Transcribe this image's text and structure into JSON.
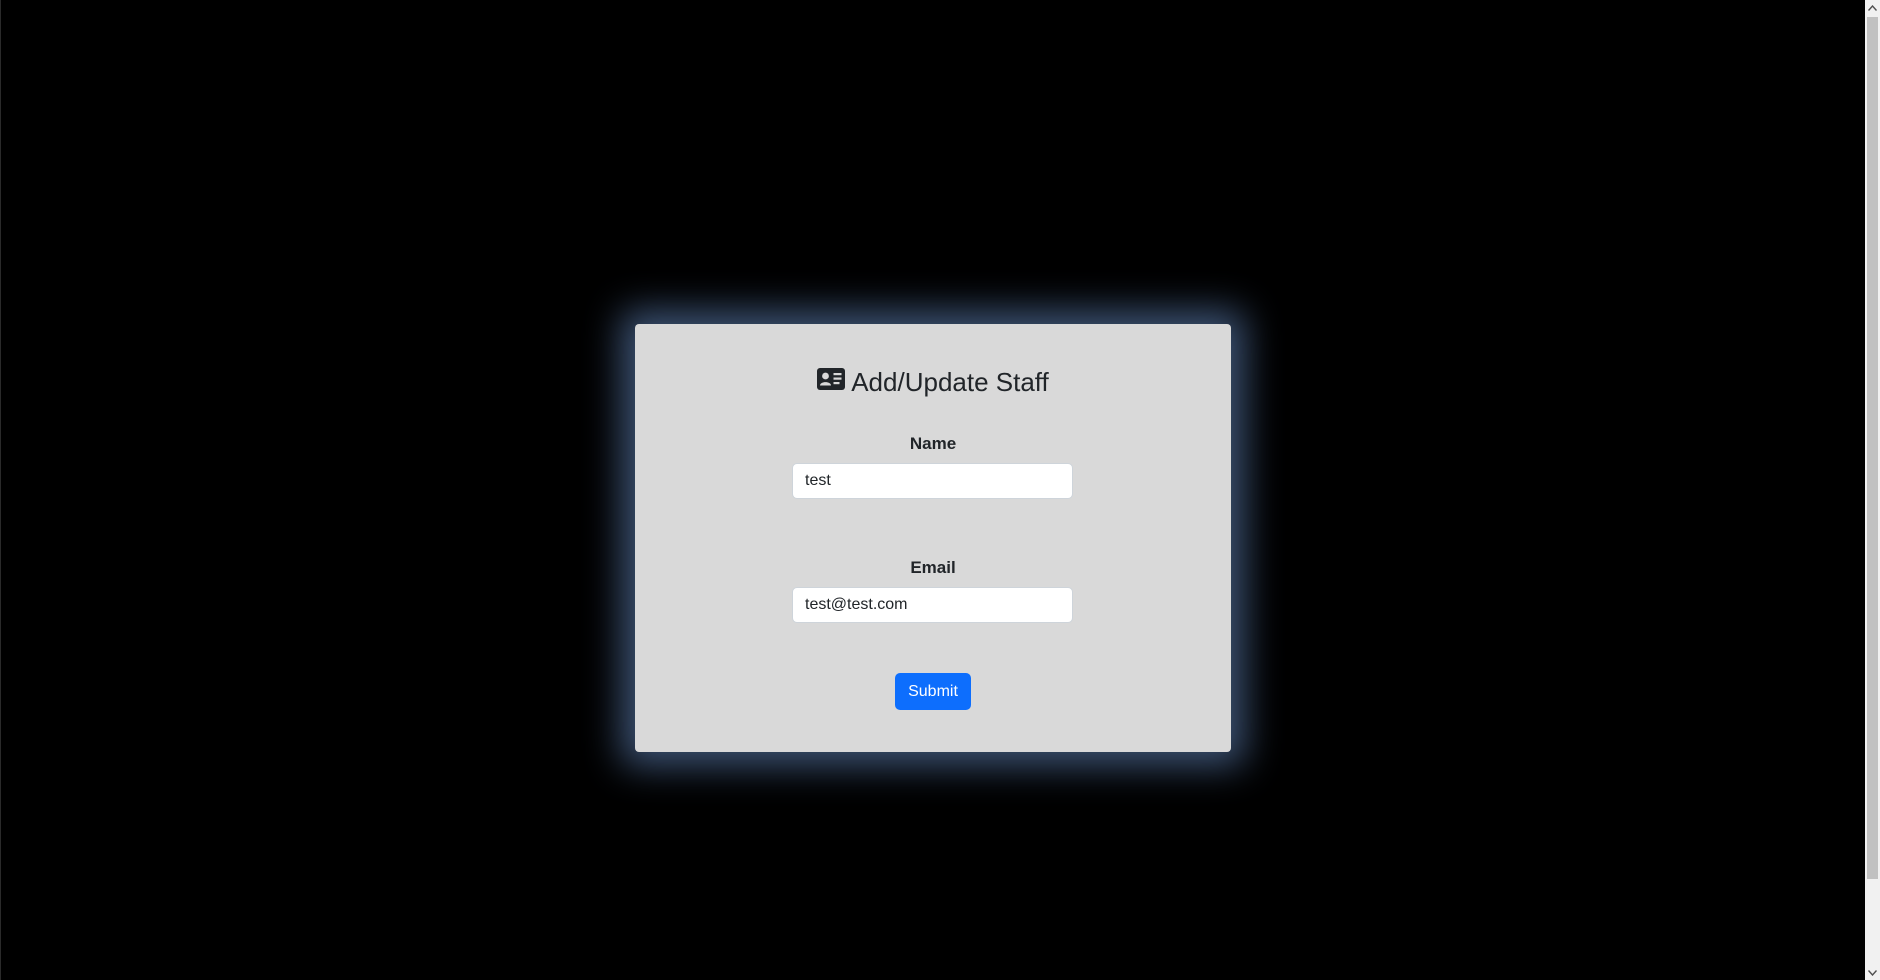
{
  "form": {
    "title": "Add/Update Staff",
    "title_icon": "id-card-icon",
    "name_label": "Name",
    "name_value": "test",
    "email_label": "Email",
    "email_value": "test@test.com",
    "submit_label": "Submit"
  },
  "colors": {
    "page_background": "#000000",
    "card_background": "#d9d9d9",
    "card_glow": "#6e96d2",
    "primary_button": "#0d6efd",
    "text": "#212529"
  },
  "scrollbar": {
    "up_icon": "chevron-up-icon",
    "down_icon": "chevron-down-icon"
  }
}
